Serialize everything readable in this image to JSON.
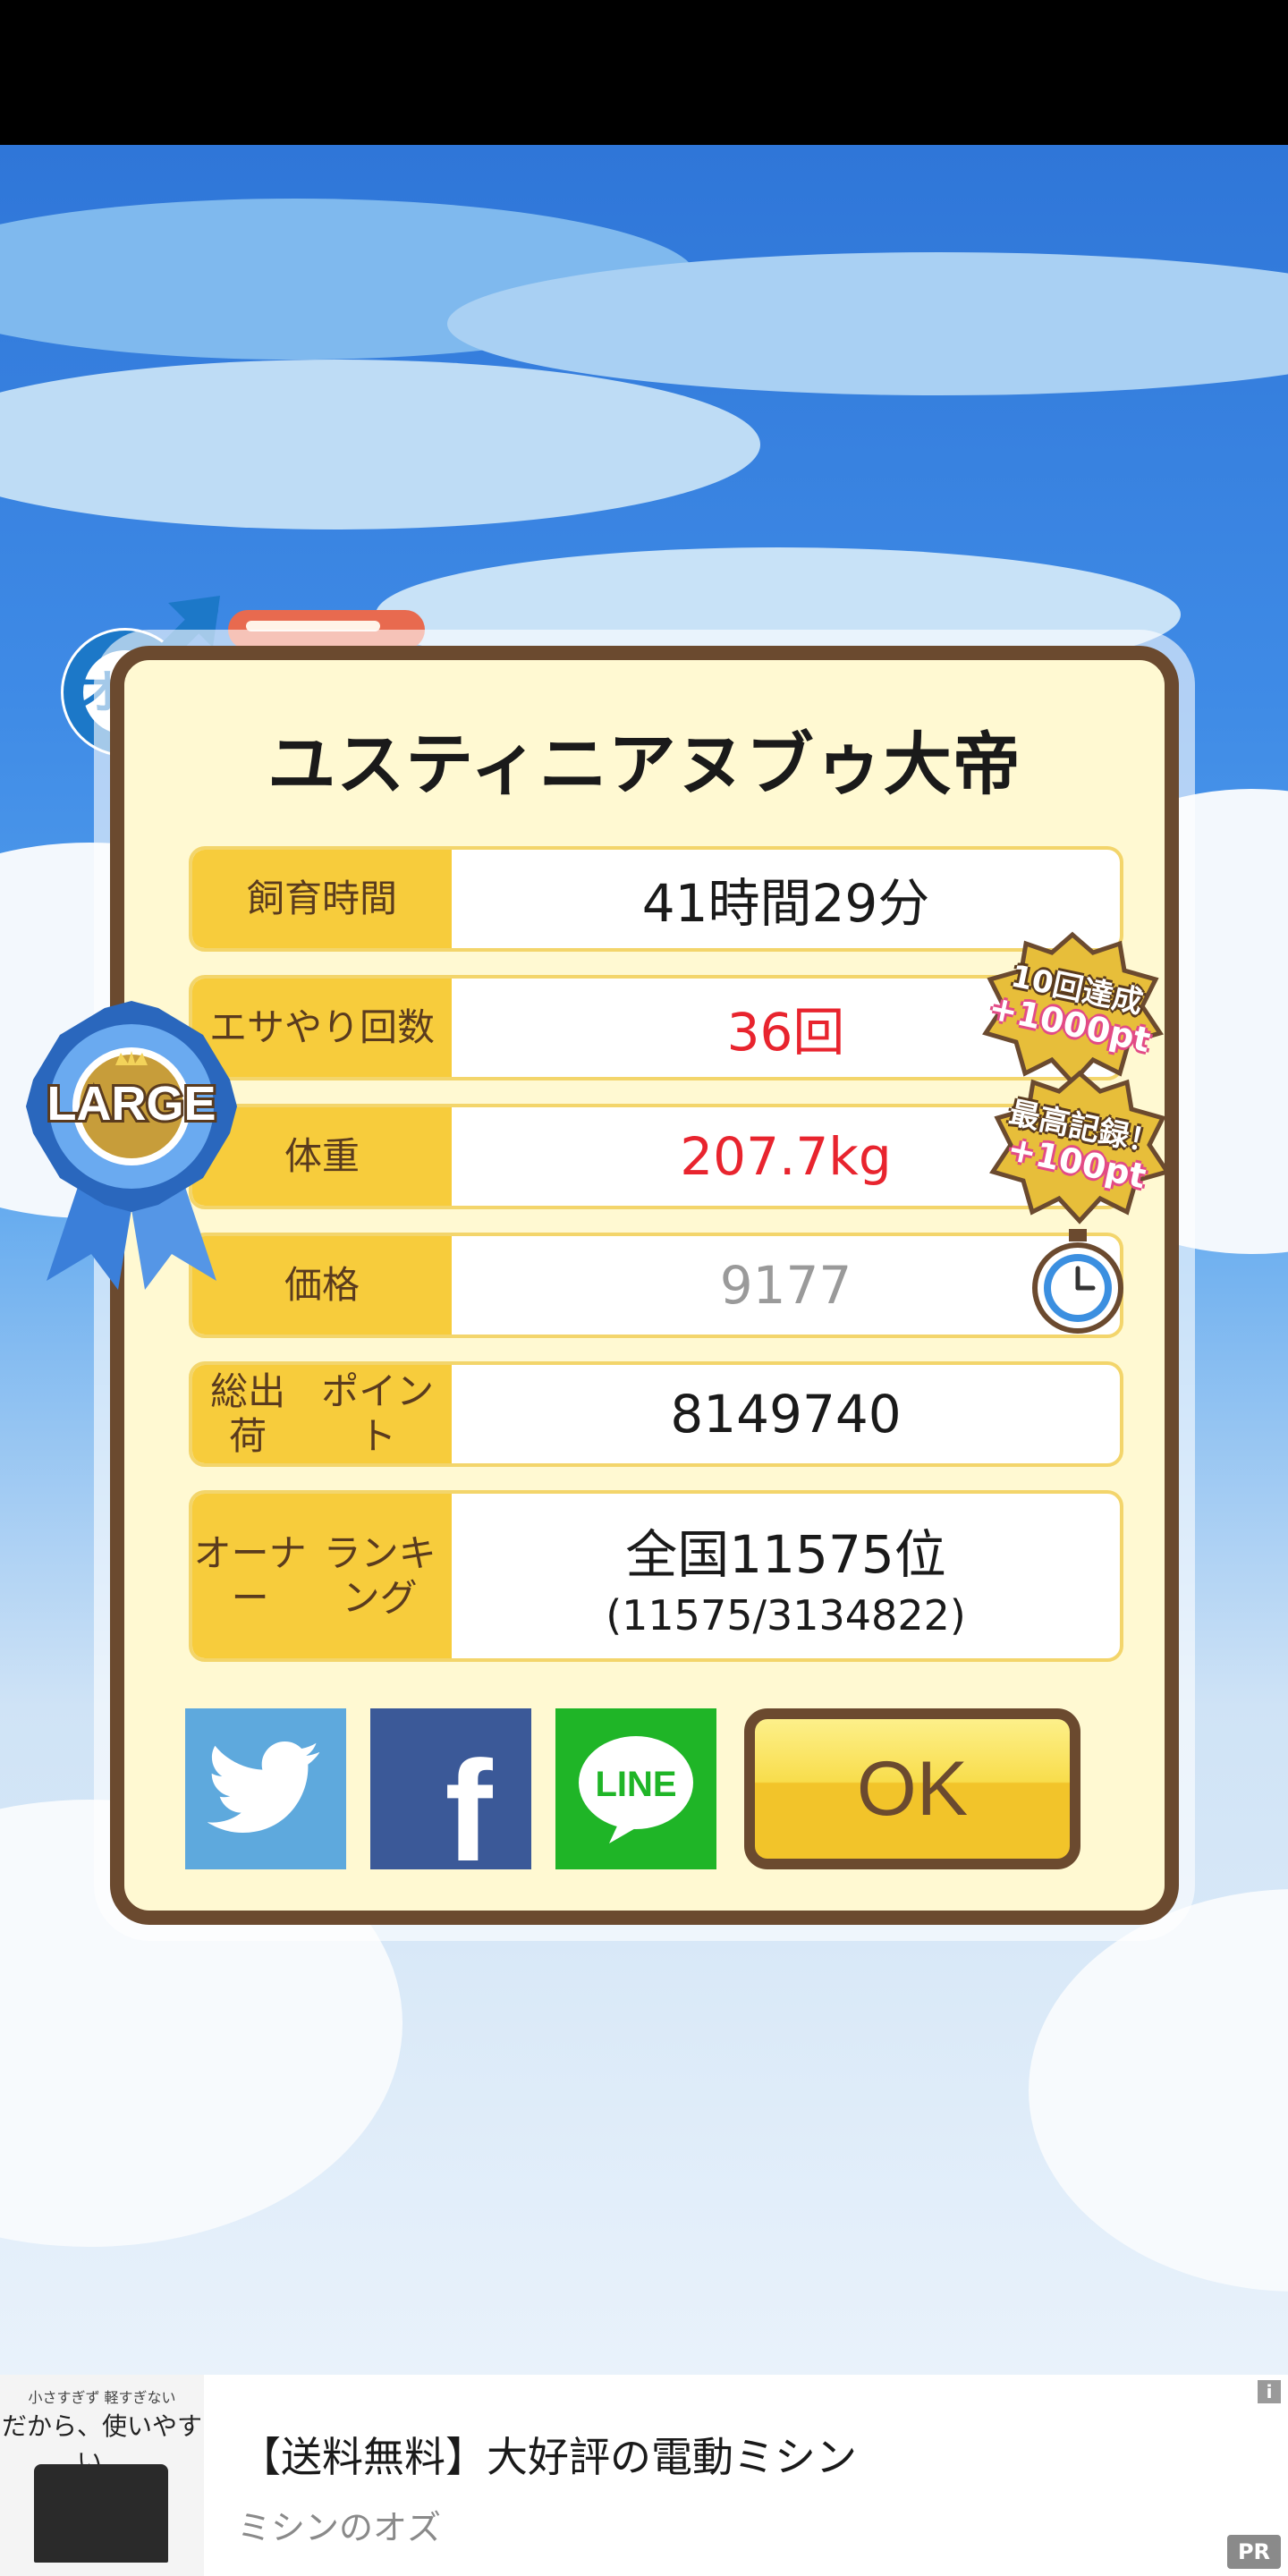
{
  "pet": {
    "name": "ユスティニアヌブゥ大帝",
    "gender_badge": "オス",
    "size_badge": "LARGE"
  },
  "stats": {
    "breeding_time": {
      "label": "飼育時間",
      "value": "41時間29分"
    },
    "feeding_count": {
      "label": "エサやり回数",
      "value": "36回"
    },
    "weight": {
      "label": "体重",
      "value": "207.7kg"
    },
    "price": {
      "label": "価格",
      "value": "9177"
    },
    "shipment_points": {
      "label_line1": "総出荷",
      "label_line2": "ポイント",
      "value": "8149740"
    },
    "owner_ranking": {
      "label_line1": "オーナー",
      "label_line2": "ランキング",
      "value_line1": "全国11575位",
      "value_line2": "(11575/3134822)"
    }
  },
  "achievements": [
    {
      "line1": "10回達成",
      "line2": "+1000pt"
    },
    {
      "line1": "最高記録！",
      "line2": "+100pt"
    }
  ],
  "share_buttons": {
    "twitter_icon": "twitter-bird-icon",
    "facebook_label": "f",
    "line_label": "LINE"
  },
  "ok_button": {
    "label": "OK"
  },
  "ad": {
    "thumb_caption_small": "小さすぎず 軽すぎない",
    "thumb_caption": "だから、使いやすい。",
    "title": "【送料無料】大好評の電動ミシン",
    "advertiser": "ミシンのオズ",
    "info_badge": "i",
    "pr_badge": "PR"
  },
  "colors": {
    "accent_label": "#f7cc3c",
    "frame_brown": "#6b4a2f",
    "highlight_red": "#e8242e"
  }
}
